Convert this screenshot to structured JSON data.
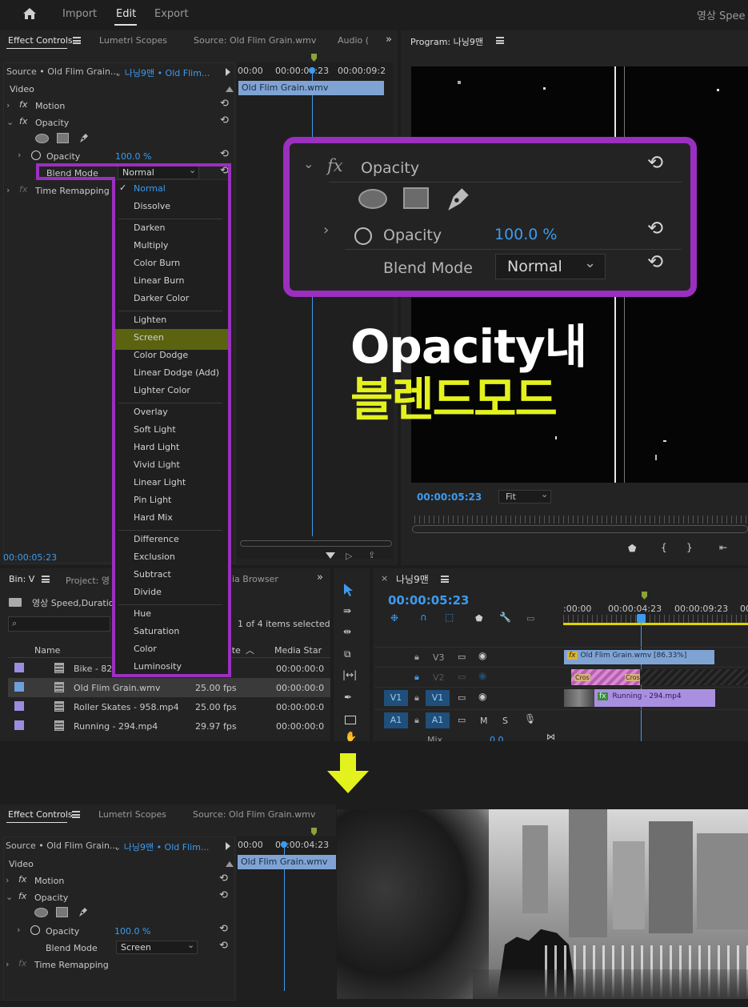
{
  "topbar": {
    "home": "home-icon",
    "import": "Import",
    "edit": "Edit",
    "export": "Export",
    "project": "영상 Spee"
  },
  "tabs": {
    "effect_controls": "Effect Controls",
    "lumetri": "Lumetri Scopes",
    "source": "Source: Old Flim Grain.wmv",
    "audio": "Audio (",
    "program": "Program: 나닝9맨"
  },
  "ec": {
    "source_sel": "Source • Old Flim Grain...",
    "seq_sel": "나닝9맨 • Old Flim...",
    "tc1": "00:00",
    "tc2": "00:00:04:23",
    "tc3": "00:00:09:2",
    "clip": "Old Flim Grain.wmv",
    "video": "Video",
    "motion": "Motion",
    "opacity": "Opacity",
    "opacity_prop": "Opacity",
    "opacity_val": "100.0 %",
    "blend": "Blend Mode",
    "blend_val": "Normal",
    "time_remap": "Time Remapping",
    "timecode": "00:00:05:23"
  },
  "menu": {
    "groups": [
      [
        "Normal",
        "Dissolve"
      ],
      [
        "Darken",
        "Multiply",
        "Color Burn",
        "Linear Burn",
        "Darker Color"
      ],
      [
        "Lighten",
        "Screen",
        "Color Dodge",
        "Linear Dodge (Add)",
        "Lighter Color"
      ],
      [
        "Overlay",
        "Soft Light",
        "Hard Light",
        "Vivid Light",
        "Linear Light",
        "Pin Light",
        "Hard Mix"
      ],
      [
        "Difference",
        "Exclusion",
        "Subtract",
        "Divide"
      ],
      [
        "Hue",
        "Saturation",
        "Color",
        "Luminosity"
      ]
    ],
    "checked": "Normal",
    "highlighted": "Screen"
  },
  "zoom": {
    "fx": "fx",
    "title": "Opacity",
    "prop": "Opacity",
    "value": "100.0 %",
    "blend": "Blend Mode",
    "blend_val": "Normal"
  },
  "overlay": {
    "line1": "Opacity내",
    "line2": "블렌드모드"
  },
  "program": {
    "timecode": "00:00:05:23",
    "fit": "Fit"
  },
  "bin": {
    "tab": "Bin: V",
    "project_tab": "Project: 영",
    "media_browser": "dia Browser",
    "path": "영상 Speed,Duratio",
    "count": "1 of 4 items selected",
    "col_name": "Name",
    "col_rate": "ate",
    "col_start": "Media Star",
    "rows": [
      {
        "name": "Bike - 826",
        "fps": "s",
        "start": "00:00:00:0"
      },
      {
        "name": "Old Flim Grain.wmv",
        "fps": "25.00 fps",
        "start": "00:00:00:0"
      },
      {
        "name": "Roller Skates - 958.mp4",
        "fps": "25.00 fps",
        "start": "00:00:00:0"
      },
      {
        "name": "Running - 294.mp4",
        "fps": "29.97 fps",
        "start": "00:00:00:0"
      }
    ]
  },
  "timeline": {
    "title": "나닝9맨",
    "timecode": "00:00:05:23",
    "r1": ":00:00",
    "r2": "00:00:04:23",
    "r3": "00:00:09:23",
    "r4": "00",
    "v3": "V3",
    "v2": "V2",
    "v1": "V1",
    "a1": "A1",
    "m": "M",
    "s": "S",
    "mix": "Mix",
    "mixval": "0.0",
    "clip_v3": "Old Flim Grain.wmv [86.33%]",
    "clip_v2a": "Cros",
    "clip_v2b": "Cros",
    "clip_v1": "Running - 294.mp4"
  },
  "bottom": {
    "effect_controls": "Effect Controls",
    "lumetri": "Lumetri Scopes",
    "source": "Source: Old Flim Grain.wmv",
    "source_sel": "Source • Old Flim Grain...",
    "seq_sel": "나닝9맨 • Old Flim...",
    "tc1": "00:00",
    "tc2": "00:00:04:23",
    "clip": "Old Flim Grain.wmv",
    "video": "Video",
    "motion": "Motion",
    "opacity": "Opacity",
    "opacity_prop": "Opacity",
    "opacity_val": "100.0 %",
    "blend": "Blend Mode",
    "blend_val": "Screen",
    "time_remap": "Time Remapping"
  },
  "colors": {
    "accent": "#3d9bef",
    "purple": "#9b2fbf",
    "lime": "#e3f21c",
    "highlight": "#5b6311"
  }
}
